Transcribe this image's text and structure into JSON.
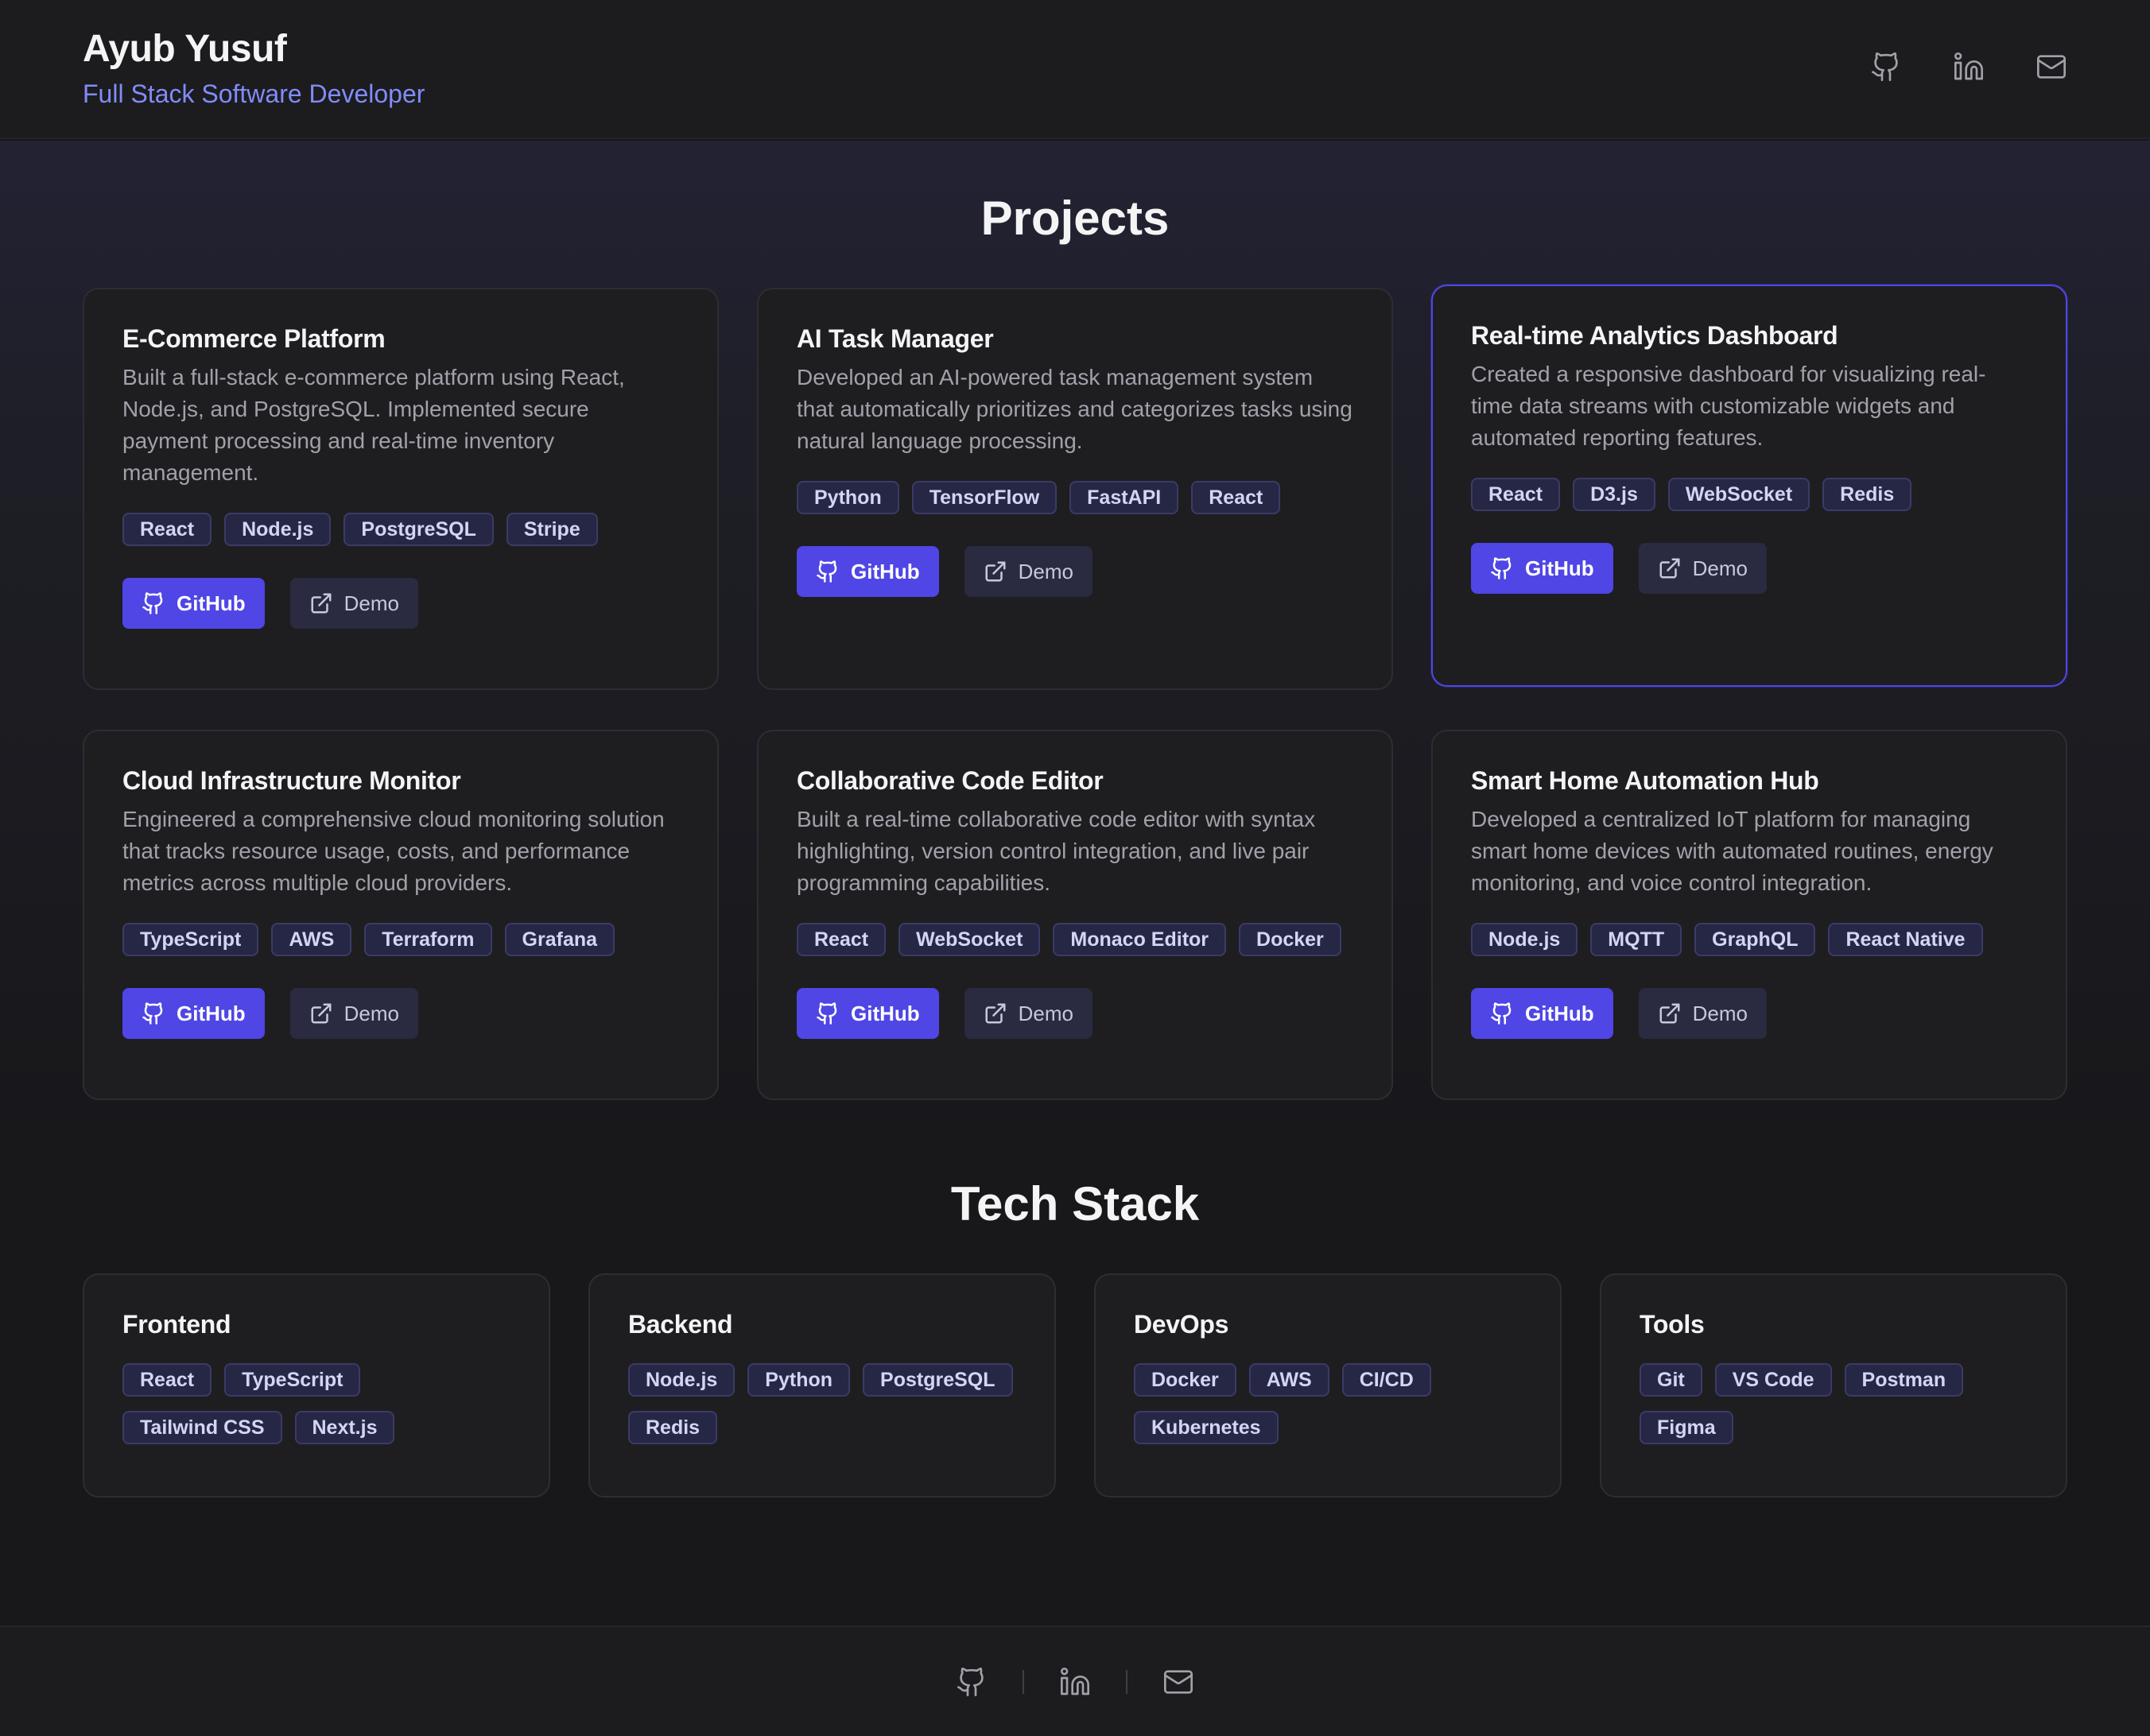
{
  "header": {
    "name": "Ayub Yusuf",
    "role": "Full Stack Software Developer",
    "icons": [
      "github-icon",
      "linkedin-icon",
      "mail-icon"
    ]
  },
  "projects": {
    "title": "Projects",
    "github_label": "GitHub",
    "demo_label": "Demo",
    "items": [
      {
        "title": "E-Commerce Platform",
        "description": "Built a full-stack e-commerce platform using React, Node.js, and PostgreSQL. Implemented secure payment processing and real-time inventory management.",
        "tags": [
          "React",
          "Node.js",
          "PostgreSQL",
          "Stripe"
        ]
      },
      {
        "title": "AI Task Manager",
        "description": "Developed an AI-powered task management system that automatically prioritizes and categorizes tasks using natural language processing.",
        "tags": [
          "Python",
          "TensorFlow",
          "FastAPI",
          "React"
        ]
      },
      {
        "title": "Real-time Analytics Dashboard",
        "description": "Created a responsive dashboard for visualizing real-time data streams with customizable widgets and automated reporting features.",
        "tags": [
          "React",
          "D3.js",
          "WebSocket",
          "Redis"
        ]
      },
      {
        "title": "Cloud Infrastructure Monitor",
        "description": "Engineered a comprehensive cloud monitoring solution that tracks resource usage, costs, and performance metrics across multiple cloud providers.",
        "tags": [
          "TypeScript",
          "AWS",
          "Terraform",
          "Grafana"
        ]
      },
      {
        "title": "Collaborative Code Editor",
        "description": "Built a real-time collaborative code editor with syntax highlighting, version control integration, and live pair programming capabilities.",
        "tags": [
          "React",
          "WebSocket",
          "Monaco Editor",
          "Docker"
        ]
      },
      {
        "title": "Smart Home Automation Hub",
        "description": "Developed a centralized IoT platform for managing smart home devices with automated routines, energy monitoring, and voice control integration.",
        "tags": [
          "Node.js",
          "MQTT",
          "GraphQL",
          "React Native"
        ]
      }
    ]
  },
  "tech_stack": {
    "title": "Tech Stack",
    "groups": [
      {
        "title": "Frontend",
        "tags": [
          "React",
          "TypeScript",
          "Tailwind CSS",
          "Next.js"
        ]
      },
      {
        "title": "Backend",
        "tags": [
          "Node.js",
          "Python",
          "PostgreSQL",
          "Redis"
        ]
      },
      {
        "title": "DevOps",
        "tags": [
          "Docker",
          "AWS",
          "CI/CD",
          "Kubernetes"
        ]
      },
      {
        "title": "Tools",
        "tags": [
          "Git",
          "VS Code",
          "Postman",
          "Figma"
        ]
      }
    ]
  },
  "footer": {
    "icons": [
      "github-icon",
      "linkedin-icon",
      "mail-icon"
    ]
  },
  "colors": {
    "background": "#18181b",
    "card": "#1e1e21",
    "accent": "#4f46e5",
    "role_text": "#818cf8",
    "tag_bg": "#262645"
  }
}
